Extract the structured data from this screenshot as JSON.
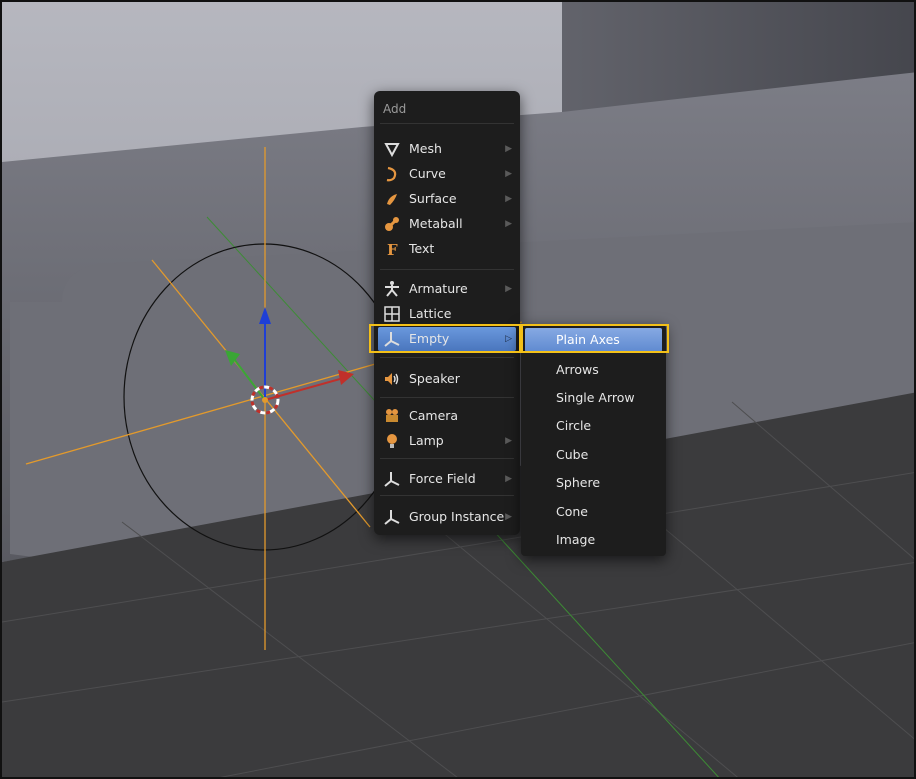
{
  "add_menu": {
    "title": "Add",
    "items": [
      {
        "label": "Mesh",
        "icon": "mesh-icon",
        "submenu": true
      },
      {
        "label": "Curve",
        "icon": "curve-icon",
        "submenu": true
      },
      {
        "label": "Surface",
        "icon": "surface-icon",
        "submenu": true
      },
      {
        "label": "Metaball",
        "icon": "metaball-icon",
        "submenu": true
      },
      {
        "label": "Text",
        "icon": "text-icon",
        "submenu": false
      },
      {
        "label": "Armature",
        "icon": "armature-icon",
        "submenu": true
      },
      {
        "label": "Lattice",
        "icon": "lattice-icon",
        "submenu": false
      },
      {
        "label": "Empty",
        "icon": "empty-icon",
        "submenu": true,
        "active": true
      },
      {
        "label": "Speaker",
        "icon": "speaker-icon",
        "submenu": false
      },
      {
        "label": "Camera",
        "icon": "camera-icon",
        "submenu": false
      },
      {
        "label": "Lamp",
        "icon": "lamp-icon",
        "submenu": true
      },
      {
        "label": "Force Field",
        "icon": "force-field-icon",
        "submenu": true
      },
      {
        "label": "Group Instance",
        "icon": "group-instance-icon",
        "submenu": true
      }
    ]
  },
  "empty_submenu": {
    "items": [
      {
        "label": "Plain Axes",
        "active": true
      },
      {
        "label": "Arrows"
      },
      {
        "label": "Single Arrow"
      },
      {
        "label": "Circle"
      },
      {
        "label": "Cube"
      },
      {
        "label": "Sphere"
      },
      {
        "label": "Cone"
      },
      {
        "label": "Image"
      }
    ]
  },
  "colors": {
    "menu_bg": "#1d1d1d",
    "highlight_border": "#f3c018",
    "active_item": "#5f8ad0",
    "axis_x": "#c0302a",
    "axis_y": "#3aa635",
    "axis_z": "#1e3fd6",
    "empty_axes": "#e39a2c"
  }
}
